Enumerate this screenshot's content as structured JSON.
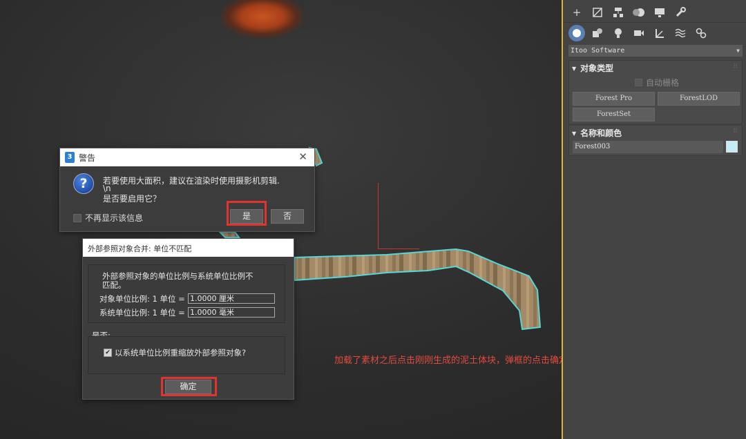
{
  "viewport": {
    "annotation": "加载了素材之后点击刚刚生成的泥土体块，弹框的点击确定"
  },
  "command_panel": {
    "toolbar_top": [
      "create-icon",
      "modify-icon",
      "hierarchy-icon",
      "motion-icon",
      "display-icon",
      "utilities-icon"
    ],
    "toolbar_categories": [
      "geometry-icon",
      "shapes-icon",
      "lights-icon",
      "cameras-icon",
      "helpers-icon",
      "spacewarps-icon",
      "systems-icon"
    ],
    "category_dropdown": "Itoo Software",
    "object_type": {
      "title": "对象类型",
      "autogrid_label": "自动栅格",
      "buttons": [
        "Forest Pro",
        "ForestLOD",
        "ForestSet"
      ]
    },
    "name_color": {
      "title": "名称和颜色",
      "name_value": "Forest003",
      "color": "#c6ecf8"
    }
  },
  "warning_dialog": {
    "title": "警告",
    "message_line1": "若要使用大面积，建议在渲染时使用摄影机剪辑.",
    "message_line2": "\\n",
    "message_line3": "是否要启用它？",
    "dont_show_label": "不再显示该信息",
    "yes_label": "是",
    "no_label": "否"
  },
  "unit_dialog": {
    "title": "外部参照对象合并: 单位不匹配",
    "desc_line1": "外部参照对象的单位比例与系统单位比例不",
    "desc_line2": "匹配。",
    "object_scale_label": "对象单位比例: 1 单位 =",
    "object_scale_value": "1.0000 厘米",
    "system_scale_label": "系统单位比例: 1 单位 =",
    "system_scale_value": "1.0000 毫米",
    "question_label": "是否:",
    "rescale_label": "以系统单位比例重缩放外部参照对象?",
    "rescale_checked": true,
    "ok_label": "确定"
  },
  "colors": {
    "highlight": "#e2342e",
    "selection_outline": "#59d6d6",
    "viewport_border": "#e2b53a"
  }
}
